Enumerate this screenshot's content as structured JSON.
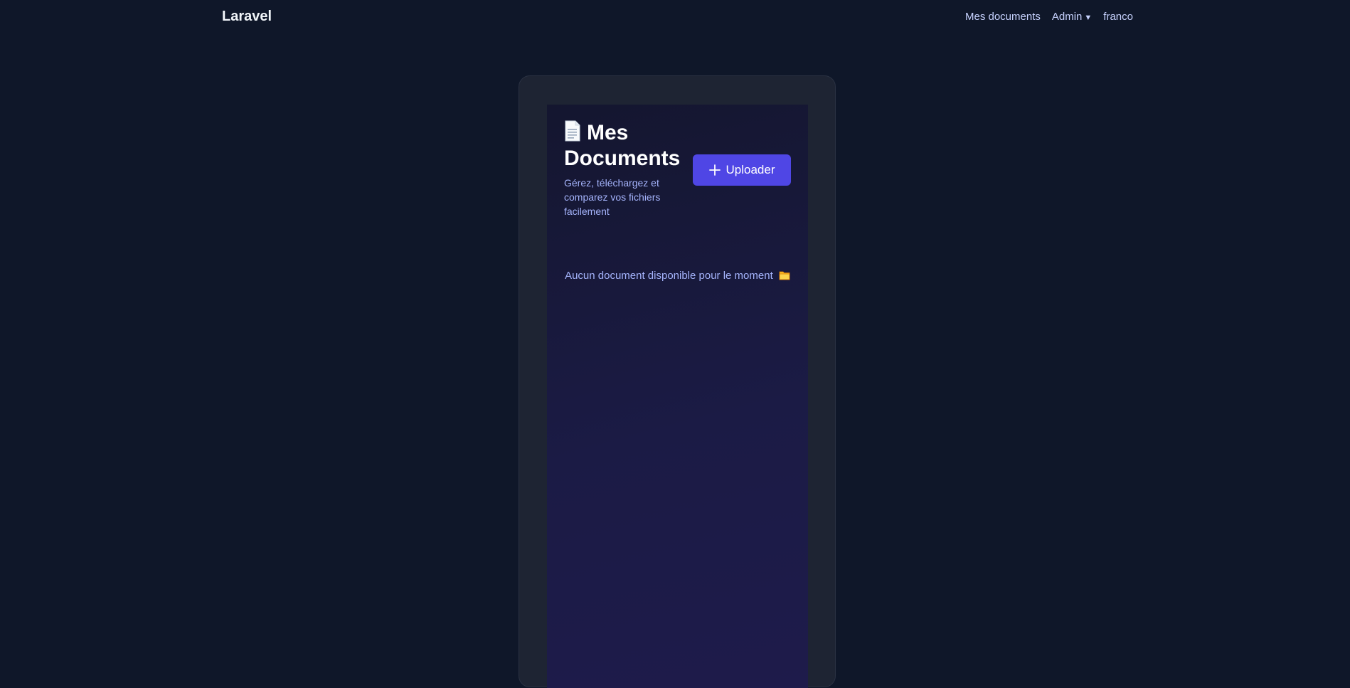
{
  "navbar": {
    "brand": "Laravel",
    "links": {
      "documents": "Mes documents",
      "admin": "Admin",
      "user": "franco"
    }
  },
  "main": {
    "title": "Mes Documents",
    "title_icon": "document-icon",
    "subtitle": "Gérez, téléchargez et comparez vos fichiers facilement",
    "upload_button": "Uploader",
    "upload_icon": "plus-icon",
    "empty_message": "Aucun document disponible pour le moment",
    "empty_icon": "folder-icon"
  },
  "colors": {
    "background": "#0f1729",
    "card": "#1e2433",
    "accent": "#4f46e5",
    "muted_text": "#a5b4fc"
  }
}
